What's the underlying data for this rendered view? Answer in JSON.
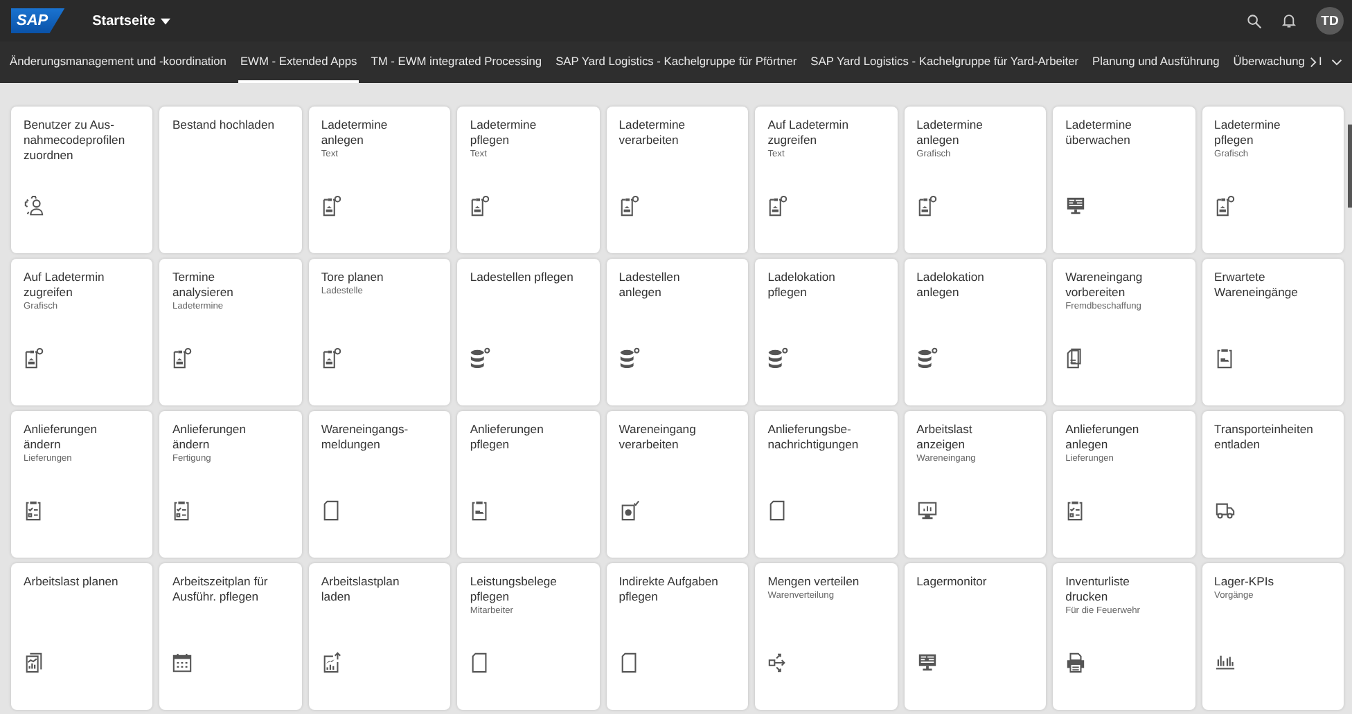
{
  "shell": {
    "logo": "SAP",
    "title": "Startseite",
    "avatar": "TD"
  },
  "tabs": [
    {
      "label": "Änderungsmanagement und -koordination",
      "selected": false
    },
    {
      "label": "EWM - Extended Apps",
      "selected": true
    },
    {
      "label": "TM - EWM integrated Processing",
      "selected": false
    },
    {
      "label": "SAP Yard Logistics - Kachelgruppe für Pförtner",
      "selected": false
    },
    {
      "label": "SAP Yard Logistics - Kachelgruppe für Yard-Arbeiter",
      "selected": false
    },
    {
      "label": "Planung und Ausführung",
      "selected": false
    },
    {
      "label": "Überwachung",
      "selected": false
    },
    {
      "label": "I",
      "selected": false
    }
  ],
  "tiles": [
    {
      "title": "Benutzer zu Aus-\nnahmecodeprofilen\nzuordnen",
      "kind": "admin"
    },
    {
      "title": "Bestand hochladen"
    },
    {
      "title": "Ladetermine\nanlegen",
      "subtitle": "Text",
      "kind": "schedule"
    },
    {
      "title": "Ladetermine\npflegen",
      "subtitle": "Text",
      "kind": "schedule"
    },
    {
      "title": "Ladetermine\nverarbeiten",
      "kind": "schedule"
    },
    {
      "title": "Auf Ladetermin\nzugreifen",
      "subtitle": "Text",
      "kind": "schedule"
    },
    {
      "title": "Ladetermine\nanlegen",
      "subtitle": "Grafisch",
      "kind": "schedule"
    },
    {
      "title": "Ladetermine\nüberwachen",
      "kind": "monitor"
    },
    {
      "title": "Ladetermine\npflegen",
      "subtitle": "Grafisch",
      "kind": "schedule"
    },
    {
      "title": "Auf Ladetermin\nzugreifen",
      "subtitle": "Grafisch",
      "kind": "schedule"
    },
    {
      "title": "Termine\nanalysieren",
      "subtitle": "Ladetermine",
      "kind": "schedule"
    },
    {
      "title": "Tore planen",
      "subtitle": "Ladestelle",
      "kind": "schedule"
    },
    {
      "title": "Ladestellen pflegen",
      "kind": "database"
    },
    {
      "title": "Ladestellen\nanlegen",
      "kind": "database"
    },
    {
      "title": "Ladelokation\npflegen",
      "kind": "database"
    },
    {
      "title": "Ladelokation\nanlegen",
      "kind": "database"
    },
    {
      "title": "Wareneingang\nvorbereiten",
      "subtitle": "Fremdbeschaffung",
      "kind": "documents"
    },
    {
      "title": "Erwartete\nWareneingänge",
      "kind": "delivery"
    },
    {
      "title": "Anlieferungen\nändern",
      "subtitle": "Lieferungen",
      "kind": "checklist"
    },
    {
      "title": "Anlieferungen\nändern",
      "subtitle": "Fertigung",
      "kind": "checklist"
    },
    {
      "title": "Wareneingangs-\nmeldungen",
      "kind": "document"
    },
    {
      "title": "Anlieferungen\npflegen",
      "kind": "delivery"
    },
    {
      "title": "Wareneingang\nverarbeiten",
      "kind": "receipt"
    },
    {
      "title": "Anlieferungsbe-\nnachrichtigungen",
      "kind": "document"
    },
    {
      "title": "Arbeitslast\nanzeigen",
      "subtitle": "Wareneingang",
      "kind": "dashboard"
    },
    {
      "title": "Anlieferungen\nanlegen",
      "subtitle": "Lieferungen",
      "kind": "checklist"
    },
    {
      "title": "Transporteinheiten\nentladen",
      "kind": "truck"
    },
    {
      "title": "Arbeitslast planen",
      "kind": "workload"
    },
    {
      "title": "Arbeitszeitplan für\nAusführ. pflegen",
      "kind": "calendar"
    },
    {
      "title": "Arbeitslastplan\nladen",
      "kind": "upload"
    },
    {
      "title": "Leistungsbelege\npflegen",
      "subtitle": "Mitarbeiter",
      "kind": "document"
    },
    {
      "title": "Indirekte Aufgaben\npflegen",
      "kind": "document"
    },
    {
      "title": "Mengen verteilen",
      "subtitle": "Warenverteilung",
      "kind": "distribute"
    },
    {
      "title": "Lagermonitor",
      "kind": "monitor"
    },
    {
      "title": "Inventurliste\ndrucken",
      "subtitle": "Für die Feuerwehr",
      "kind": "printer"
    },
    {
      "title": "Lager-KPIs",
      "subtitle": "Vorgänge",
      "kind": "kpi"
    }
  ]
}
